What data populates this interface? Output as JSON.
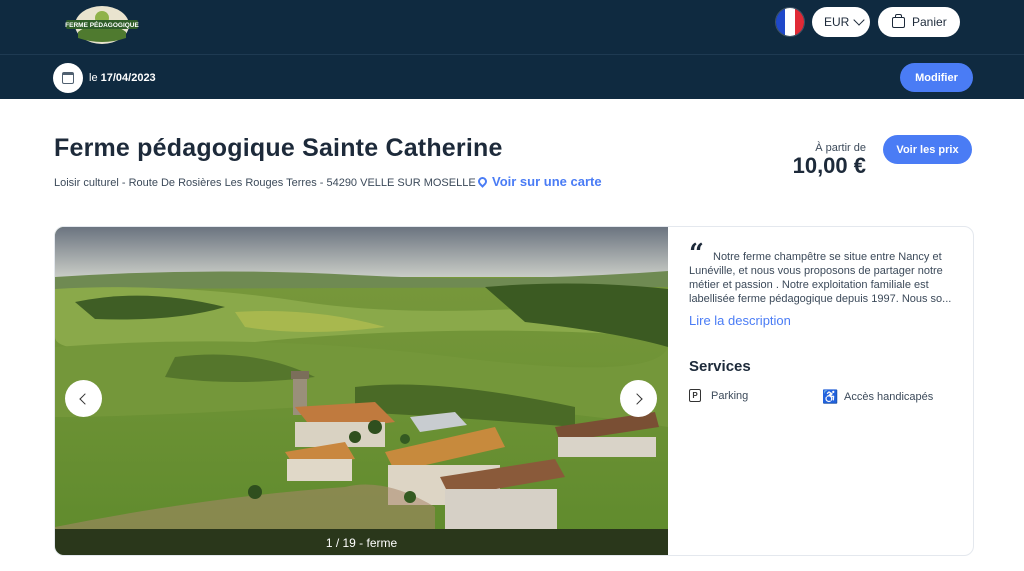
{
  "header": {
    "logo_text": "FERME PÉDAGOGIQUE",
    "currency": "EUR",
    "cart_label": "Panier",
    "colors": {
      "navy": "#0f2a40",
      "accent": "#4a7cf5"
    }
  },
  "datebar": {
    "prefix": "le",
    "date": "17/04/2023",
    "modify_label": "Modifier"
  },
  "listing": {
    "title": "Ferme pédagogique Sainte Catherine",
    "subtitle": "Loisir culturel - Route De Rosières Les Rouges Terres - 54290 VELLE SUR MOSELLE",
    "map_link": "Voir sur une carte",
    "price_from": "À partir de",
    "price": "10,00 €",
    "prices_button": "Voir les prix"
  },
  "gallery": {
    "caption": "1 / 19 - ferme"
  },
  "description": {
    "text": "Notre ferme champêtre se situe entre Nancy et Lunéville, et nous vous proposons de partager notre métier et passion . Notre exploitation familiale est labellisée ferme pédagogique depuis 1997. Nous so...",
    "read_more": "Lire la description"
  },
  "services": {
    "title": "Services",
    "items": [
      {
        "label": "Parking",
        "icon": "parking-icon"
      },
      {
        "label": "Accès handicapés",
        "icon": "wheelchair-icon"
      }
    ]
  }
}
